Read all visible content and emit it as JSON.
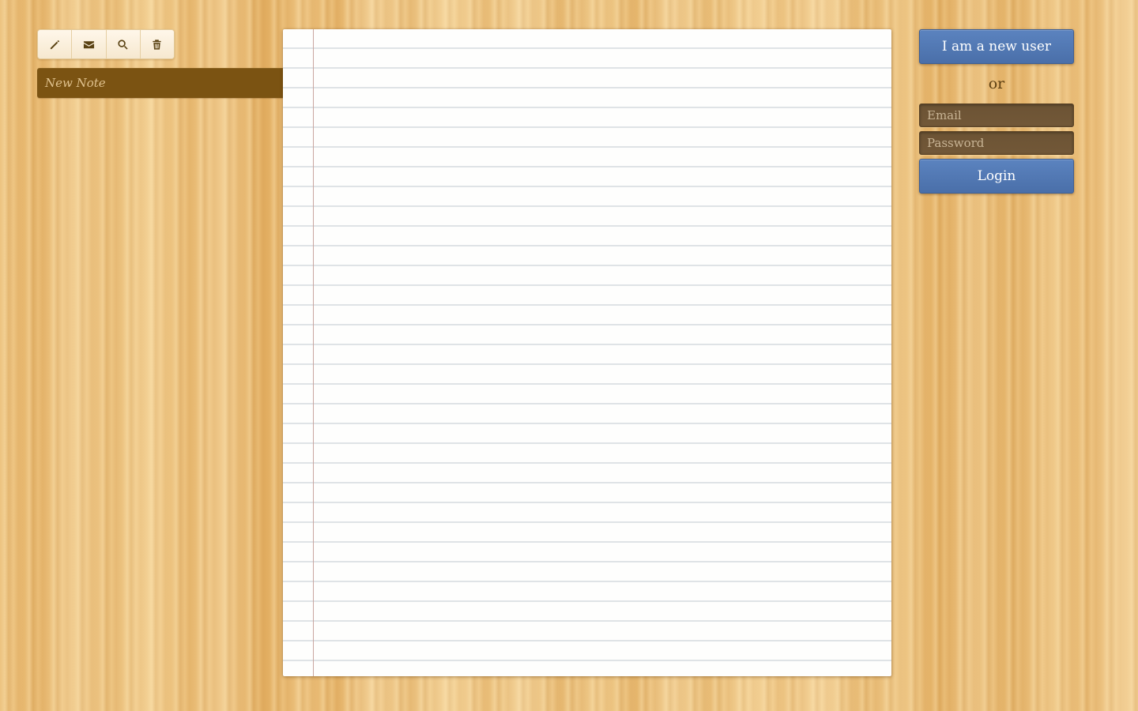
{
  "toolbar": {
    "buttons": [
      {
        "id": "new",
        "icon": "pencil-icon"
      },
      {
        "id": "email",
        "icon": "envelope-icon"
      },
      {
        "id": "search",
        "icon": "search-icon"
      },
      {
        "id": "delete",
        "icon": "trash-icon"
      }
    ]
  },
  "notes": {
    "items": [
      {
        "title": "New Note"
      }
    ]
  },
  "paper": {
    "content": ""
  },
  "auth": {
    "new_user_label": "I am a new user",
    "or_label": "or",
    "email_placeholder": "Email",
    "password_placeholder": "Password",
    "login_label": "Login"
  },
  "colors": {
    "accent_blue": "#4a6fa9",
    "note_selected": "#7b5312",
    "wood": "#e8b96c",
    "paper": "#fefefd",
    "paper_margin_line": "#c9a6a0"
  }
}
